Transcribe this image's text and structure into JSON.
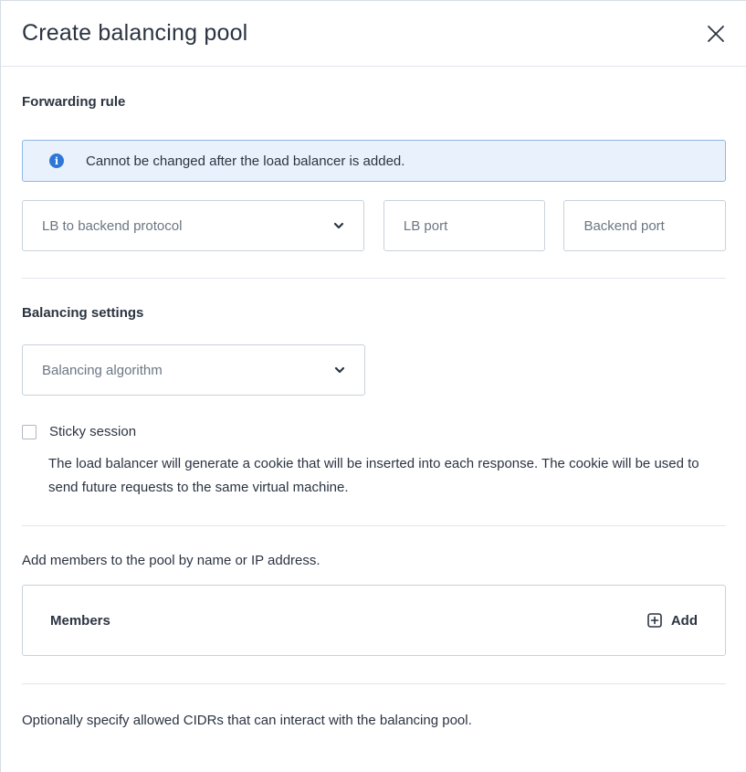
{
  "dialog": {
    "title": "Create balancing pool",
    "close_icon": "close-icon"
  },
  "forwarding": {
    "section_title": "Forwarding rule",
    "info_text": "Cannot be changed after the load balancer is added.",
    "info_icon": "info-icon",
    "protocol_placeholder": "LB to backend protocol",
    "lb_port_placeholder": "LB port",
    "backend_port_placeholder": "Backend port"
  },
  "balancing": {
    "section_title": "Balancing settings",
    "algorithm_placeholder": "Balancing algorithm",
    "sticky_label": "Sticky session",
    "sticky_checked": false,
    "sticky_help": "The load balancer will generate a cookie that will be inserted into each response. The cookie will be used to send future requests to the same virtual machine."
  },
  "members": {
    "intro": "Add members to the pool by name or IP address.",
    "label": "Members",
    "add_label": "Add",
    "add_icon": "plus-square-icon"
  },
  "cidrs": {
    "intro": "Optionally specify allowed CIDRs that can interact with the balancing pool."
  },
  "colors": {
    "info_bg": "#e9f2fc",
    "info_border": "#8fb6e6",
    "info_icon": "#2f77d6",
    "text": "#2b3441",
    "placeholder": "#6b7684",
    "border": "#c9d1db"
  }
}
